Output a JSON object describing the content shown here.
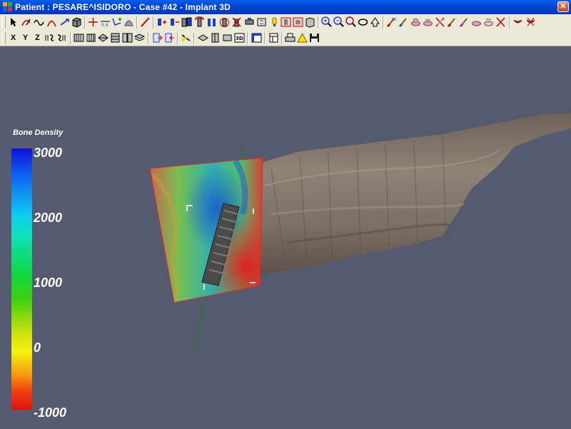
{
  "window": {
    "title": "Patient : PESARE^ISIDORO - Case #42 - Implant 3D",
    "close_label": "✕"
  },
  "toolbar": {
    "row2_axis_labels": [
      "X",
      "Y",
      "Z"
    ]
  },
  "legend": {
    "title": "Bone Density",
    "ticks": [
      "3000",
      "2000",
      "1000",
      "0",
      "-1000"
    ],
    "scale_min": -1000,
    "scale_max": 3000,
    "colors": {
      "high": "#1010d8",
      "mid_high": "#10e0f0",
      "mid": "#10d840",
      "low": "#f8f010",
      "min": "#e01010"
    }
  },
  "viewport": {
    "background": "#565a6e"
  }
}
